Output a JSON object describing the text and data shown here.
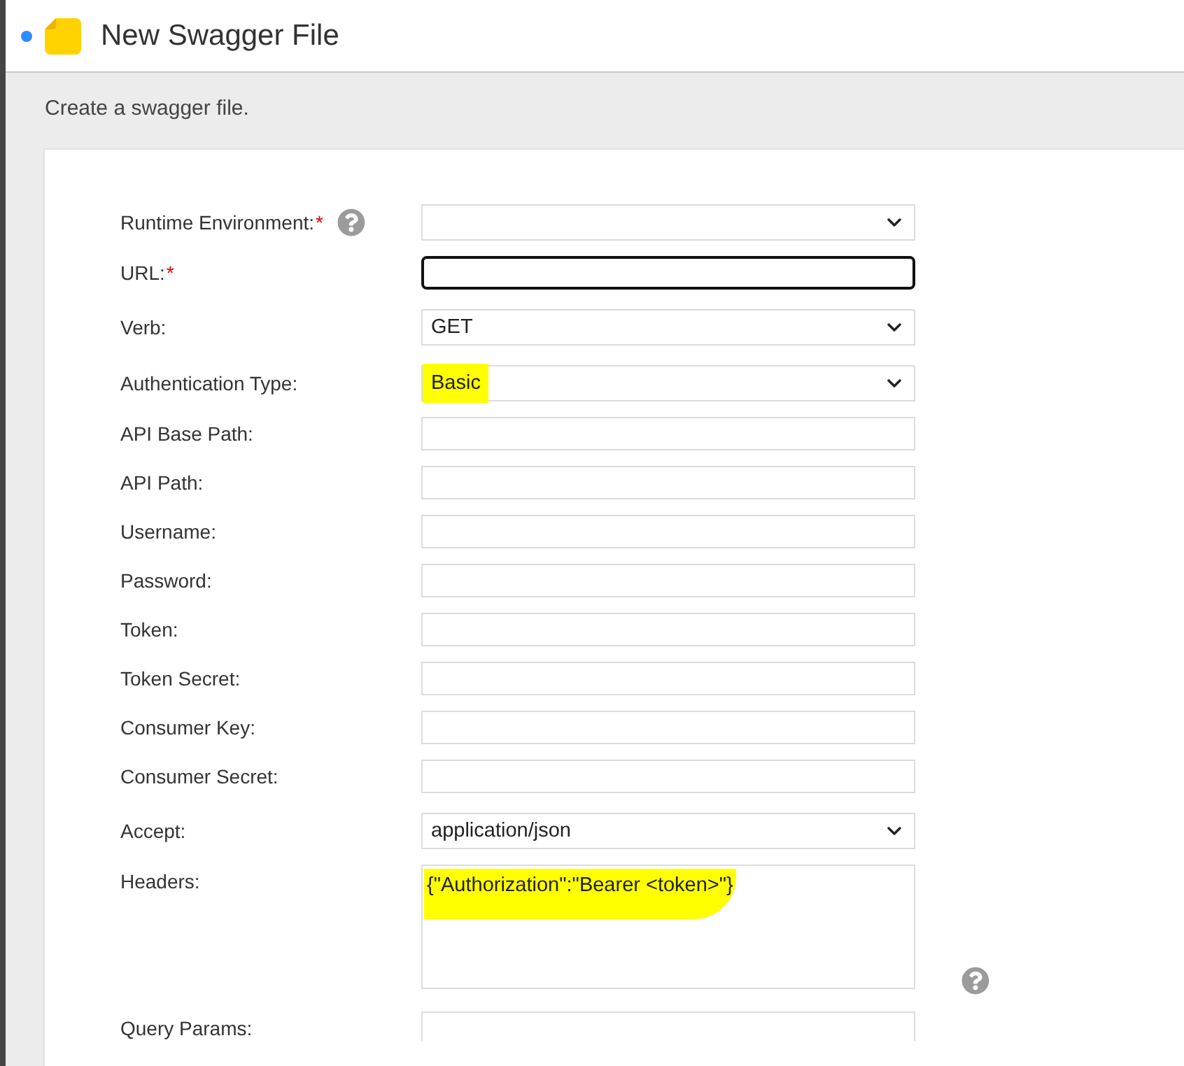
{
  "header": {
    "title": "New Swagger File"
  },
  "description": "Create a swagger file.",
  "fields": [
    {
      "label": "Runtime Environment:",
      "required_mark": "*",
      "help": true,
      "kind": "select",
      "focused": false
    },
    {
      "label": "URL:",
      "required_mark": "*",
      "help": false,
      "kind": "text",
      "focused": true
    },
    {
      "label": "Verb:",
      "help": false,
      "kind": "select",
      "value": "GET",
      "highlighted": false,
      "focused": false
    },
    {
      "label": "Authentication Type:",
      "help": false,
      "kind": "select",
      "value": "Basic",
      "highlighted": true,
      "focused": false
    },
    {
      "label": "API Base Path:",
      "help": false,
      "kind": "text",
      "focused": false
    },
    {
      "label": "API Path:",
      "help": false,
      "kind": "text",
      "focused": false
    },
    {
      "label": "Username:",
      "help": false,
      "kind": "text",
      "focused": false
    },
    {
      "label": "Password:",
      "help": false,
      "kind": "text",
      "focused": false
    },
    {
      "label": "Token:",
      "help": false,
      "kind": "text",
      "focused": false
    },
    {
      "label": "Token Secret:",
      "help": false,
      "kind": "text",
      "focused": false
    },
    {
      "label": "Consumer Key:",
      "help": false,
      "kind": "text",
      "focused": false
    },
    {
      "label": "Consumer Secret:",
      "help": false,
      "kind": "text",
      "focused": false
    },
    {
      "label": "Accept:",
      "help": false,
      "kind": "select",
      "value": "application/json",
      "highlighted": false,
      "focused": false
    },
    {
      "label": "Headers:",
      "help": true,
      "kind": "textarea",
      "value": "{\"Authorization\":\"Bearer <token>\"}",
      "highlighted": true,
      "focused": false
    },
    {
      "label": "Query Params:",
      "help": false,
      "kind": "text",
      "focused": false
    }
  ]
}
